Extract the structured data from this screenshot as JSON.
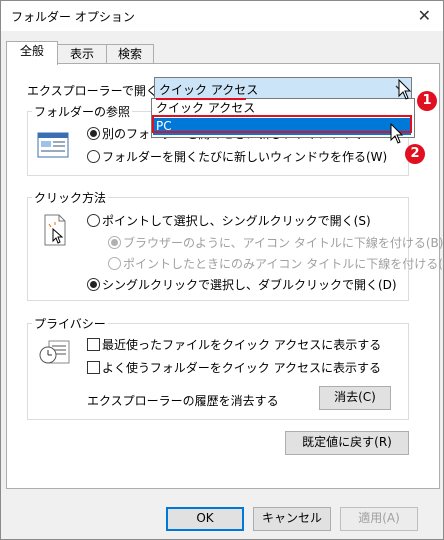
{
  "window": {
    "title": "フォルダー オプション",
    "close_glyph": "✕"
  },
  "tabs": [
    {
      "label": "全般"
    },
    {
      "label": "表示"
    },
    {
      "label": "検索"
    }
  ],
  "open_explorer": {
    "label": "エクスプローラーで開く:",
    "selected": "クイック アクセス",
    "options": [
      "クイック アクセス",
      "PC"
    ],
    "highlighted_index": 1
  },
  "folder_browse": {
    "title": "フォルダーの参照",
    "same_window": "別のフォルダーを開くときに新しいウィンドウを作らない(M)",
    "new_window": "フォルダーを開くたびに新しいウィンドウを作る(W)"
  },
  "click": {
    "title": "クリック方法",
    "single": "ポイントして選択し、シングルクリックで開く(S)",
    "underline_browser": "ブラウザーのように、アイコン タイトルに下線を付ける(B)",
    "underline_point": "ポイントしたときにのみアイコン タイトルに下線を付ける(P)",
    "double": "シングルクリックで選択し、ダブルクリックで開く(D)"
  },
  "privacy": {
    "title": "プライバシー",
    "recent_files": "最近使ったファイルをクイック アクセスに表示する",
    "frequent_folders": "よく使うフォルダーをクイック アクセスに表示する",
    "clear_history": "エクスプローラーの履歴を消去する",
    "clear_button": "消去(C)"
  },
  "restore_button": "既定値に戻す(R)",
  "buttons": {
    "ok": "OK",
    "cancel": "キャンセル",
    "apply": "適用(A)"
  },
  "annotations": [
    "1",
    "2"
  ],
  "colors": {
    "accent": "#0078d7",
    "badge": "#e01020",
    "highlight_box": "#e01020"
  }
}
